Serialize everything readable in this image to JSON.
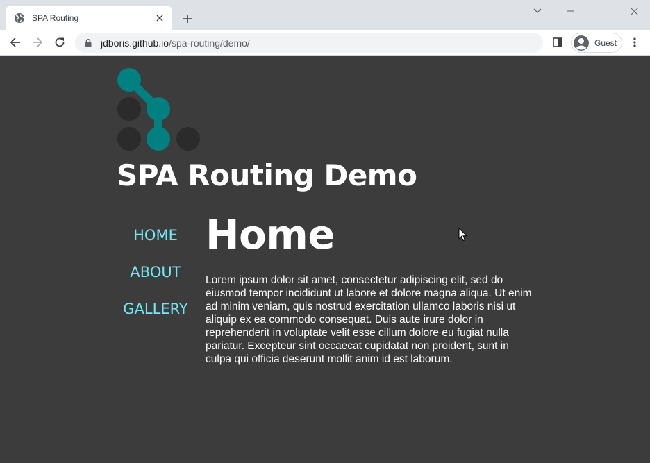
{
  "browser": {
    "tab": {
      "title": "SPA Routing"
    },
    "url": {
      "host": "jdboris.github.io",
      "path": "/spa-routing/demo/"
    },
    "profile": {
      "label": "Guest"
    }
  },
  "site": {
    "title": "SPA Routing Demo",
    "nav": [
      {
        "label": "HOME"
      },
      {
        "label": "ABOUT"
      },
      {
        "label": "GALLERY"
      }
    ]
  },
  "content": {
    "title": "Home",
    "body": "Lorem ipsum dolor sit amet, consectetur adipiscing elit, sed do eiusmod tempor incididunt ut labore et dolore magna aliqua. Ut enim ad minim veniam, quis nostrud exercitation ullamco laboris nisi ut aliquip ex ea commodo consequat. Duis aute irure dolor in reprehenderit in voluptate velit esse cillum dolore eu fugiat nulla pariatur. Excepteur sint occaecat cupidatat non proident, sunt in culpa qui officia deserunt mollit anim id est laborum."
  },
  "colors": {
    "page_bg": "#3c3c3c",
    "accent": "#74e6f2",
    "logo_teal": "#008080",
    "logo_dark": "#2b2b2b"
  }
}
